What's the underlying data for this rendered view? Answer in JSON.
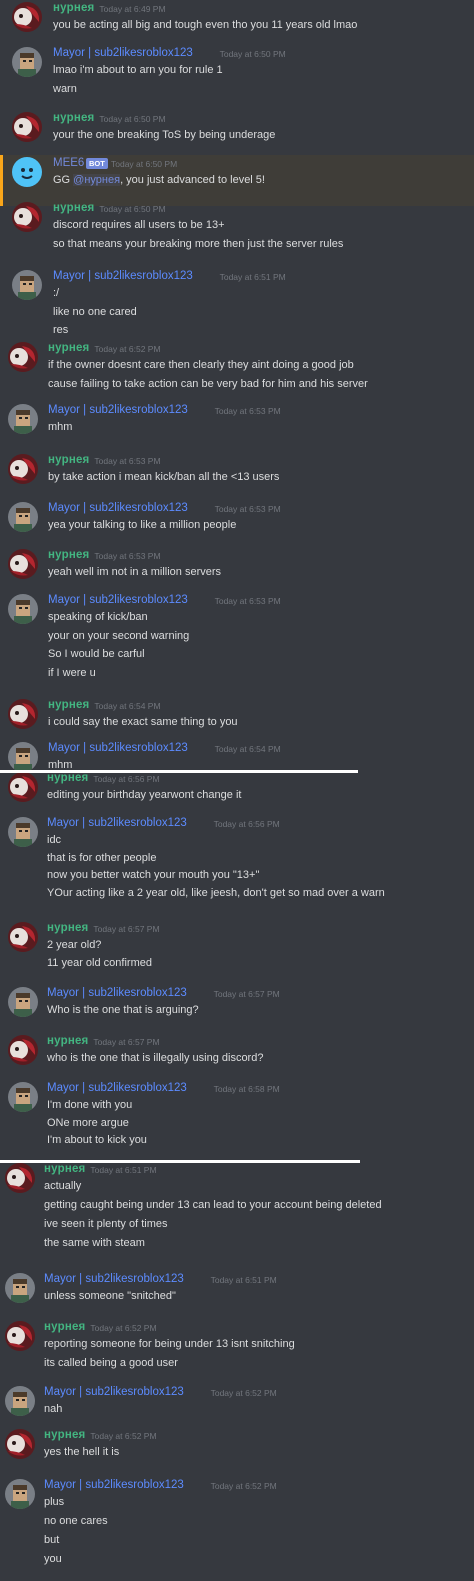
{
  "users": {
    "u1": "нурнея",
    "u2": "Mayor | sub2likesroblox123",
    "bot": "MEE6",
    "bot_badge": "BOT"
  },
  "strip1": [
    {
      "user": "u1",
      "ts": "Today at 6:49 PM",
      "lines": [
        "you be acting all big and tough even tho you 11 years old lmao"
      ]
    },
    {
      "user": "u2",
      "ts": "Today at 6:50 PM",
      "lines": [
        "lmao i'm about to arn you for rule 1",
        "warn"
      ]
    },
    {
      "user": "u1",
      "ts": "Today at 6:50 PM",
      "lines": [
        "your the one breaking ToS by being underage"
      ]
    },
    {
      "user": "bot",
      "ts": "Today at 6:50 PM",
      "lines": [
        "GG ",
        "@нурнея",
        ", you just advanced to level 5!"
      ]
    },
    {
      "user": "u1",
      "ts": "Today at 6:50 PM",
      "lines": [
        "discord requires all users to be 13+",
        "so that means your breaking more then just the server rules"
      ]
    },
    {
      "user": "u2",
      "ts": "Today at 6:51 PM",
      "lines": [
        ":/",
        "like no one cared",
        "res"
      ]
    }
  ],
  "strip2": [
    {
      "user": "u1",
      "ts": "Today at 6:52 PM",
      "lines": [
        "if the owner doesnt care then clearly they aint doing a good job",
        "cause failing to take action can be very bad for him and his server"
      ]
    },
    {
      "user": "u2",
      "ts": "Today at 6:53 PM",
      "lines": [
        "mhm"
      ]
    },
    {
      "user": "u1",
      "ts": "Today at 6:53 PM",
      "lines": [
        "by take action i mean kick/ban all the <13 users"
      ]
    },
    {
      "user": "u2",
      "ts": "Today at 6:53 PM",
      "lines": [
        "yea your talking to like a million people"
      ]
    },
    {
      "user": "u1",
      "ts": "Today at 6:53 PM",
      "lines": [
        "yeah well im not in a million servers"
      ]
    },
    {
      "user": "u2",
      "ts": "Today at 6:53 PM",
      "lines": [
        "speaking of kick/ban",
        "your on your second warning",
        "So I would be carful",
        "if I were u"
      ]
    },
    {
      "user": "u1",
      "ts": "Today at 6:54 PM",
      "lines": [
        "i could say the exact same thing to you"
      ]
    },
    {
      "user": "u2",
      "ts": "Today at 6:54 PM",
      "lines": [
        "mhm"
      ]
    }
  ],
  "strip3": [
    {
      "user": "u1",
      "ts": "Today at 6:56 PM",
      "lines": [
        "editing your birthday yearwont change it"
      ]
    },
    {
      "user": "u2",
      "ts": "Today at 6:56 PM",
      "lines": [
        "idc",
        "that is for other people",
        "now you better watch your mouth you \"13+\"",
        "YOur acting like a 2 year old, like jeesh, don't get so mad over a warn"
      ]
    },
    {
      "user": "u1",
      "ts": "Today at 6:57 PM",
      "lines": [
        "2 year old?",
        "11 year old confirmed"
      ]
    },
    {
      "user": "u2",
      "ts": "Today at 6:57 PM",
      "lines": [
        "Who is the one that is arguing?"
      ]
    },
    {
      "user": "u1",
      "ts": "Today at 6:57 PM",
      "lines": [
        "who is the one that is illegally using discord?"
      ]
    },
    {
      "user": "u2",
      "ts": "Today at 6:58 PM",
      "lines": [
        "I'm done with you",
        "ONe more argue",
        "I'm about to kick you"
      ]
    }
  ],
  "strip4": [
    {
      "user": "u1",
      "ts": "Today at 6:51 PM",
      "lines": [
        "actually",
        "getting caught being under 13 can lead to your account being deleted",
        "ive seen it plenty of times",
        "the same with steam"
      ]
    },
    {
      "user": "u2",
      "ts": "Today at 6:51 PM",
      "lines": [
        "unless someone \"snitched\""
      ]
    },
    {
      "user": "u1",
      "ts": "Today at 6:52 PM",
      "lines": [
        "reporting someone for being under 13 isnt snitching",
        "its called being a good user"
      ]
    },
    {
      "user": "u2",
      "ts": "Today at 6:52 PM",
      "lines": [
        "nah"
      ]
    },
    {
      "user": "u1",
      "ts": "Today at 6:52 PM",
      "lines": [
        "yes the hell it is"
      ]
    },
    {
      "user": "u2",
      "ts": "Today at 6:52 PM",
      "lines": [
        "plus",
        "no one cares",
        "but",
        "you"
      ]
    }
  ]
}
